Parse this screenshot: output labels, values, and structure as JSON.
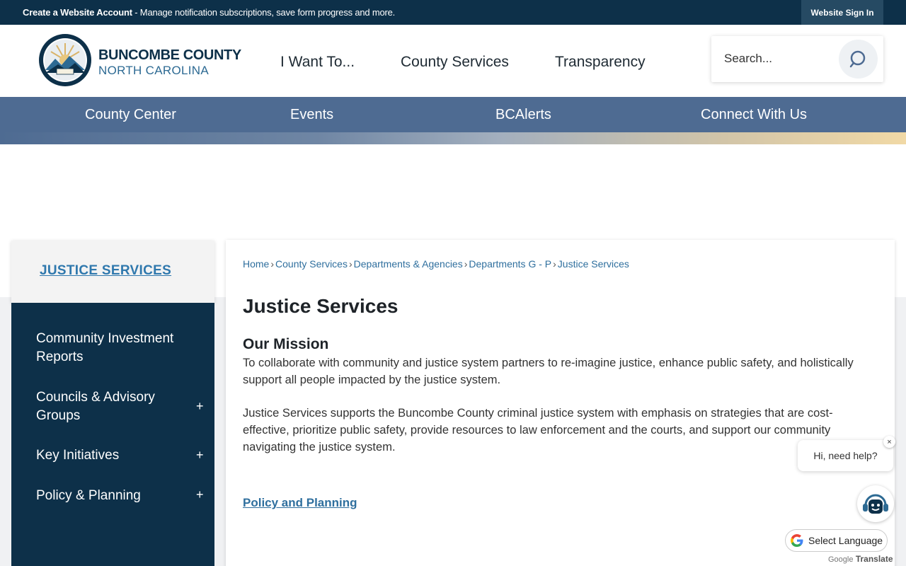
{
  "topbar": {
    "create_bold": "Create a Website Account",
    "create_rest": " - Manage notification subscriptions, save form progress and more.",
    "signin": "Website Sign In"
  },
  "brand": {
    "line1": "BUNCOMBE COUNTY",
    "line2": "NORTH CAROLINA",
    "seal_text": "BUNCOMBE COUNTY"
  },
  "main_nav": [
    "I Want To...",
    "County Services",
    "Transparency"
  ],
  "search": {
    "placeholder": "Search..."
  },
  "sub_nav": [
    "County Center",
    "Events",
    "BCAlerts",
    "Connect With Us"
  ],
  "sidebar": {
    "heading": "JUSTICE SERVICES",
    "items": [
      {
        "label": "Community Investment Reports",
        "expandable": false
      },
      {
        "label": "Councils & Advisory Groups",
        "expandable": true
      },
      {
        "label": "Key Initiatives",
        "expandable": true
      },
      {
        "label": "Policy & Planning",
        "expandable": true
      }
    ],
    "expand_symbol": "+"
  },
  "breadcrumb": [
    "Home",
    "County Services",
    "Departments & Agencies",
    "Departments G - P",
    "Justice Services"
  ],
  "breadcrumb_sep": "›",
  "page": {
    "title": "Justice Services",
    "mission_heading": "Our Mission",
    "mission_text": "To collaborate with community and justice system partners to re-imagine justice, enhance public safety, and holistically support all people impacted by the justice system.",
    "body_text": "Justice Services supports the Buncombe County criminal justice system with emphasis on strategies that are cost-effective, prioritize public safety, provide resources to law enforcement and the courts, and support our community navigating the justice system.",
    "link": "Policy and Planning"
  },
  "chat": {
    "greeting": "Hi, need help?",
    "close": "×"
  },
  "translate": {
    "label": "Select Language",
    "powered_google": "Google",
    "powered_translate": "Translate"
  },
  "colors": {
    "navy": "#0d3049",
    "subnav": "#4e6b92",
    "link": "#2f6f9e"
  }
}
